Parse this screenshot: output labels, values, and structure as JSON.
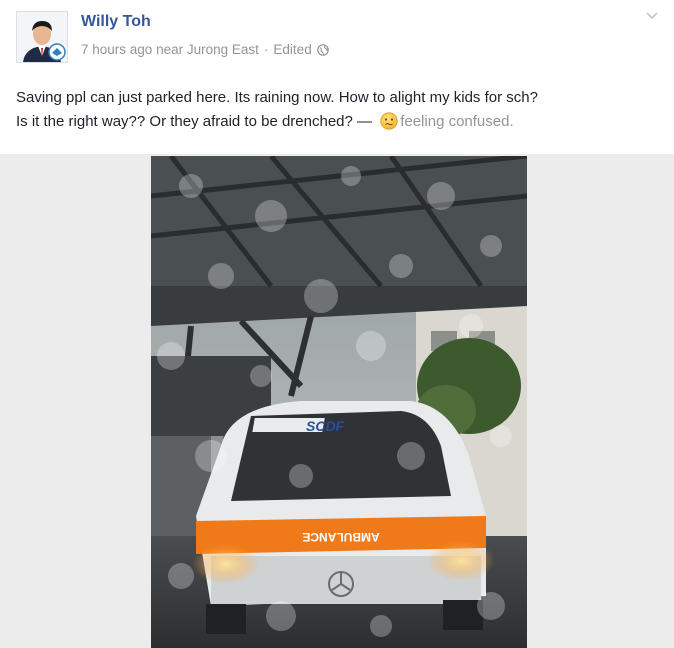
{
  "post": {
    "author": "Willy Toh",
    "time": "7 hours ago",
    "location_prefix": "near",
    "location": "Jurong East",
    "separator": "·",
    "edited": "Edited",
    "privacy_icon": "globe-icon",
    "menu_icon": "chevron-down-icon",
    "text_line1": "Saving ppl can just parked here. Its raining now. How to alight my kids for sch?",
    "text_line2": "Is it the right way?? Or they afraid to be drenched? —",
    "feeling_icon": "confused-face-icon",
    "feeling_label": "feeling",
    "feeling_value": "confused.",
    "photo": {
      "vehicle_text": "SCDF",
      "bonnet_text": "AMBULANCE"
    }
  },
  "colors": {
    "author_link": "#365899",
    "meta_gray": "#90949c",
    "text": "#1d2129",
    "photo_background": "#ececec",
    "ambulance_stripe": "#f07a1a"
  }
}
